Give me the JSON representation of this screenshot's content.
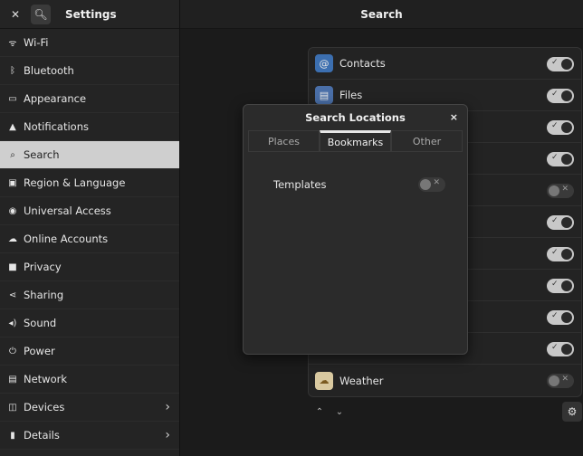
{
  "sidebar": {
    "title": "Settings",
    "items": [
      {
        "label": "Wi-Fi",
        "icon": "wifi-icon"
      },
      {
        "label": "Bluetooth",
        "icon": "bluetooth-icon"
      },
      {
        "label": "Appearance",
        "icon": "appearance-icon"
      },
      {
        "label": "Notifications",
        "icon": "bell-icon"
      },
      {
        "label": "Search",
        "icon": "search-icon",
        "active": true
      },
      {
        "label": "Region & Language",
        "icon": "region-icon"
      },
      {
        "label": "Universal Access",
        "icon": "accessibility-icon"
      },
      {
        "label": "Online Accounts",
        "icon": "accounts-icon"
      },
      {
        "label": "Privacy",
        "icon": "privacy-icon"
      },
      {
        "label": "Sharing",
        "icon": "share-icon"
      },
      {
        "label": "Sound",
        "icon": "speaker-icon"
      },
      {
        "label": "Power",
        "icon": "power-icon"
      },
      {
        "label": "Network",
        "icon": "network-icon"
      },
      {
        "label": "Devices",
        "icon": "devices-icon",
        "chevron": true
      },
      {
        "label": "Details",
        "icon": "info-icon",
        "chevron": true
      }
    ]
  },
  "main": {
    "title": "Search",
    "apps": [
      {
        "label": "Contacts",
        "on": true
      },
      {
        "label": "Files",
        "on": true
      },
      {
        "label": "",
        "on": true
      },
      {
        "label": "",
        "on": true
      },
      {
        "label": "",
        "on": false
      },
      {
        "label": "",
        "on": true
      },
      {
        "label": "",
        "on": true
      },
      {
        "label": "",
        "on": true
      },
      {
        "label": "",
        "on": true
      },
      {
        "label": "",
        "on": true
      },
      {
        "label": "Weather",
        "on": false
      }
    ]
  },
  "dialog": {
    "title": "Search Locations",
    "close": "×",
    "tabs": [
      "Places",
      "Bookmarks",
      "Other"
    ],
    "active_tab": 1,
    "row_label": "Templates",
    "row_on": false
  },
  "colors": {
    "accent": "#e6e6e6",
    "active_item_bg": "#cfcfcf"
  }
}
